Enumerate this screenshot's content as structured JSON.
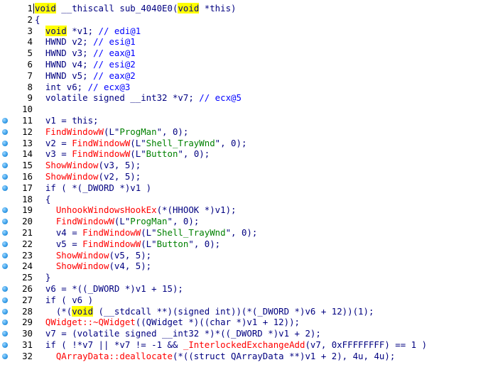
{
  "editor": {
    "highlight_color": "#ffff00",
    "breakpoint_color": "#3aa0ea",
    "lines": [
      {
        "n": "1",
        "bp": false,
        "tokens": [
          [
            "hl kw",
            "void"
          ],
          [
            "op",
            " __thiscall "
          ],
          [
            "op",
            "sub_4040E0("
          ],
          [
            "hl kw",
            "void"
          ],
          [
            "op",
            " *this)"
          ]
        ]
      },
      {
        "n": "2",
        "bp": false,
        "tokens": [
          [
            "op",
            "{"
          ]
        ]
      },
      {
        "n": "3",
        "bp": false,
        "tokens": [
          [
            "op",
            "  "
          ],
          [
            "hl kw",
            "void"
          ],
          [
            "op",
            " *v1; "
          ],
          [
            "cmt",
            "// edi@1"
          ]
        ]
      },
      {
        "n": "4",
        "bp": false,
        "tokens": [
          [
            "op",
            "  HWND v2; "
          ],
          [
            "cmt",
            "// esi@1"
          ]
        ]
      },
      {
        "n": "5",
        "bp": false,
        "tokens": [
          [
            "op",
            "  HWND v3; "
          ],
          [
            "cmt",
            "// eax@1"
          ]
        ]
      },
      {
        "n": "6",
        "bp": false,
        "tokens": [
          [
            "op",
            "  HWND v4; "
          ],
          [
            "cmt",
            "// esi@2"
          ]
        ]
      },
      {
        "n": "7",
        "bp": false,
        "tokens": [
          [
            "op",
            "  HWND v5; "
          ],
          [
            "cmt",
            "// eax@2"
          ]
        ]
      },
      {
        "n": "8",
        "bp": false,
        "tokens": [
          [
            "op",
            "  int v6; "
          ],
          [
            "cmt",
            "// ecx@3"
          ]
        ]
      },
      {
        "n": "9",
        "bp": false,
        "tokens": [
          [
            "op",
            "  volatile signed __int32 *v7; "
          ],
          [
            "cmt",
            "// ecx@5"
          ]
        ]
      },
      {
        "n": "10",
        "bp": false,
        "tokens": []
      },
      {
        "n": "11",
        "bp": true,
        "tokens": [
          [
            "op",
            "  v1 = this;"
          ]
        ]
      },
      {
        "n": "12",
        "bp": true,
        "tokens": [
          [
            "op",
            "  "
          ],
          [
            "fn",
            "FindWindowW"
          ],
          [
            "op",
            "(L\""
          ],
          [
            "str",
            "ProgMan"
          ],
          [
            "op",
            "\", 0);"
          ]
        ]
      },
      {
        "n": "13",
        "bp": true,
        "tokens": [
          [
            "op",
            "  v2 = "
          ],
          [
            "fn",
            "FindWindowW"
          ],
          [
            "op",
            "(L\""
          ],
          [
            "str",
            "Shell_TrayWnd"
          ],
          [
            "op",
            "\", 0);"
          ]
        ]
      },
      {
        "n": "14",
        "bp": true,
        "tokens": [
          [
            "op",
            "  v3 = "
          ],
          [
            "fn",
            "FindWindowW"
          ],
          [
            "op",
            "(L\""
          ],
          [
            "str",
            "Button"
          ],
          [
            "op",
            "\", 0);"
          ]
        ]
      },
      {
        "n": "15",
        "bp": true,
        "tokens": [
          [
            "op",
            "  "
          ],
          [
            "fn",
            "ShowWindow"
          ],
          [
            "op",
            "(v3, 5);"
          ]
        ]
      },
      {
        "n": "16",
        "bp": true,
        "tokens": [
          [
            "op",
            "  "
          ],
          [
            "fn",
            "ShowWindow"
          ],
          [
            "op",
            "(v2, 5);"
          ]
        ]
      },
      {
        "n": "17",
        "bp": true,
        "tokens": [
          [
            "op",
            "  if ( *(_DWORD *)v1 )"
          ]
        ]
      },
      {
        "n": "18",
        "bp": false,
        "tokens": [
          [
            "op",
            "  {"
          ]
        ]
      },
      {
        "n": "19",
        "bp": true,
        "tokens": [
          [
            "op",
            "    "
          ],
          [
            "fn",
            "UnhookWindowsHookEx"
          ],
          [
            "op",
            "(*(HHOOK *)v1);"
          ]
        ]
      },
      {
        "n": "20",
        "bp": true,
        "tokens": [
          [
            "op",
            "    "
          ],
          [
            "fn",
            "FindWindowW"
          ],
          [
            "op",
            "(L\""
          ],
          [
            "str",
            "ProgMan"
          ],
          [
            "op",
            "\", 0);"
          ]
        ]
      },
      {
        "n": "21",
        "bp": true,
        "tokens": [
          [
            "op",
            "    v4 = "
          ],
          [
            "fn",
            "FindWindowW"
          ],
          [
            "op",
            "(L\""
          ],
          [
            "str",
            "Shell_TrayWnd"
          ],
          [
            "op",
            "\", 0);"
          ]
        ]
      },
      {
        "n": "22",
        "bp": true,
        "tokens": [
          [
            "op",
            "    v5 = "
          ],
          [
            "fn",
            "FindWindowW"
          ],
          [
            "op",
            "(L\""
          ],
          [
            "str",
            "Button"
          ],
          [
            "op",
            "\", 0);"
          ]
        ]
      },
      {
        "n": "23",
        "bp": true,
        "tokens": [
          [
            "op",
            "    "
          ],
          [
            "fn",
            "ShowWindow"
          ],
          [
            "op",
            "(v5, 5);"
          ]
        ]
      },
      {
        "n": "24",
        "bp": true,
        "tokens": [
          [
            "op",
            "    "
          ],
          [
            "fn",
            "ShowWindow"
          ],
          [
            "op",
            "(v4, 5);"
          ]
        ]
      },
      {
        "n": "25",
        "bp": false,
        "tokens": [
          [
            "op",
            "  }"
          ]
        ]
      },
      {
        "n": "26",
        "bp": true,
        "tokens": [
          [
            "op",
            "  v6 = *((_DWORD *)v1 + 15);"
          ]
        ]
      },
      {
        "n": "27",
        "bp": true,
        "tokens": [
          [
            "op",
            "  if ( v6 )"
          ]
        ]
      },
      {
        "n": "28",
        "bp": true,
        "tokens": [
          [
            "op",
            "    (*("
          ],
          [
            "hl kw",
            "void"
          ],
          [
            "op",
            " (__stdcall **)(signed int))(*(_DWORD *)v6 + 12))(1);"
          ]
        ]
      },
      {
        "n": "29",
        "bp": true,
        "tokens": [
          [
            "op",
            "  "
          ],
          [
            "fn",
            "QWidget::~QWidget"
          ],
          [
            "op",
            "((QWidget *)((char *)v1 + 12));"
          ]
        ]
      },
      {
        "n": "30",
        "bp": true,
        "tokens": [
          [
            "op",
            "  v7 = (volatile signed __int32 *)*((_DWORD *)v1 + 2);"
          ]
        ]
      },
      {
        "n": "31",
        "bp": true,
        "tokens": [
          [
            "op",
            "  if ( !*v7 || *v7 != -1 && "
          ],
          [
            "fn",
            "_InterlockedExchangeAdd"
          ],
          [
            "op",
            "(v7, 0xFFFFFFFF) == 1 )"
          ]
        ]
      },
      {
        "n": "32",
        "bp": true,
        "tokens": [
          [
            "op",
            "    "
          ],
          [
            "fn",
            "QArrayData::deallocate"
          ],
          [
            "op",
            "(*((struct QArrayData **)v1 + 2), 4u, 4u);"
          ]
        ]
      }
    ]
  }
}
